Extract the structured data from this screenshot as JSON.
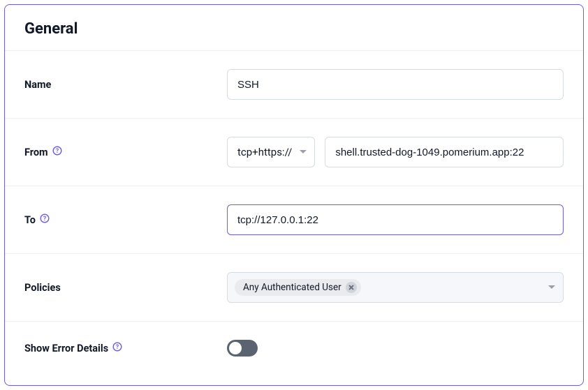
{
  "section_title": "General",
  "fields": {
    "name": {
      "label": "Name",
      "value": "SSH"
    },
    "from": {
      "label": "From",
      "protocol": "tcp+https://",
      "host": "shell.trusted-dog-1049.pomerium.app:22"
    },
    "to": {
      "label": "To",
      "value": "tcp://127.0.0.1:22"
    },
    "policies": {
      "label": "Policies",
      "chips": [
        "Any Authenticated User"
      ]
    },
    "show_error_details": {
      "label": "Show Error Details",
      "enabled": false
    }
  }
}
